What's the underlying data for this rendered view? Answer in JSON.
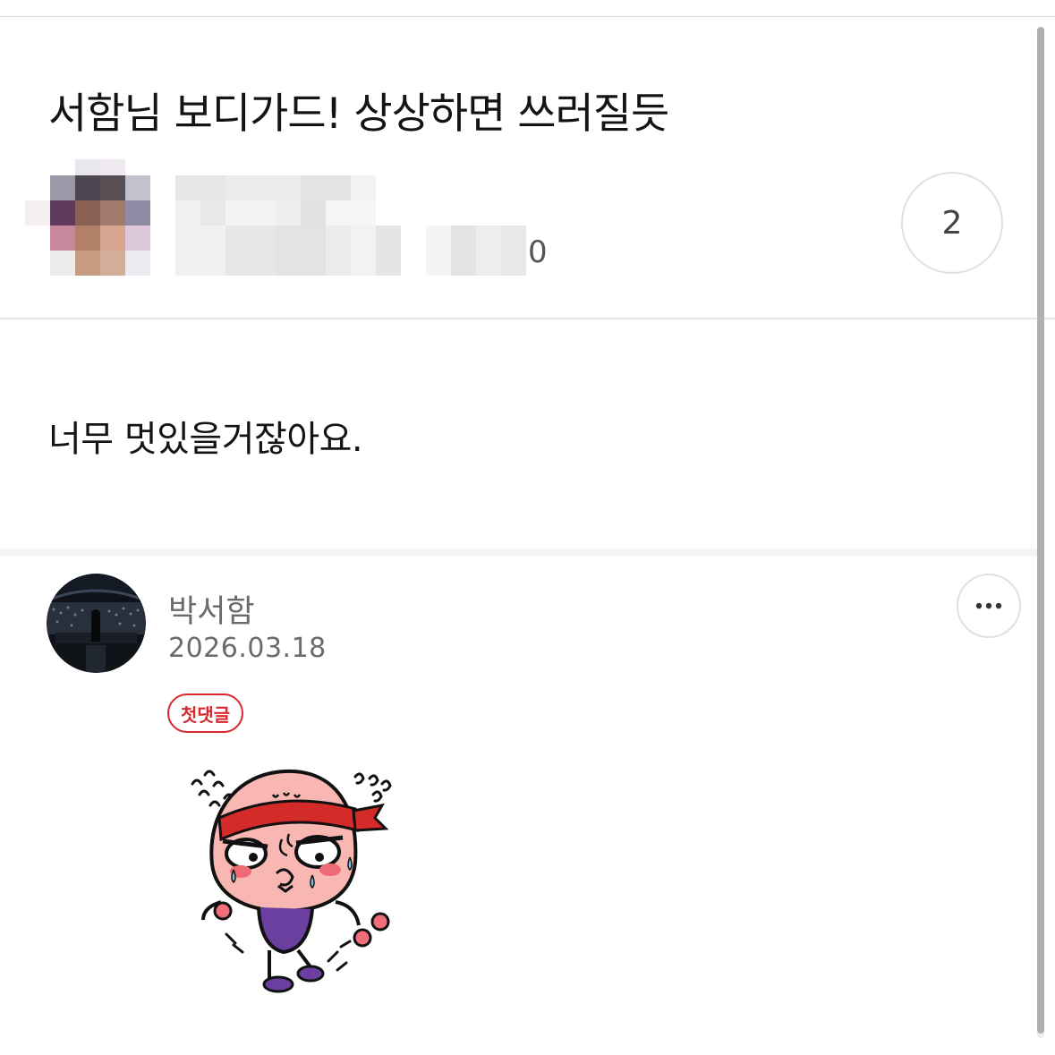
{
  "post": {
    "title": "서함님 보디가드! 상상하면 쓰러질듯",
    "body": "너무 멋있을거잖아요.",
    "view_count": "0",
    "comment_count": "2"
  },
  "comment": {
    "author": "박서함",
    "date": "2026.03.18",
    "badge": "첫댓글",
    "more_icon": "more-horizontal-icon",
    "sticker": "sweating-peach-runner-sticker"
  },
  "colors": {
    "badge_red": "#d9272d",
    "muted_text": "#6b6b6b",
    "title_text": "#141414"
  }
}
